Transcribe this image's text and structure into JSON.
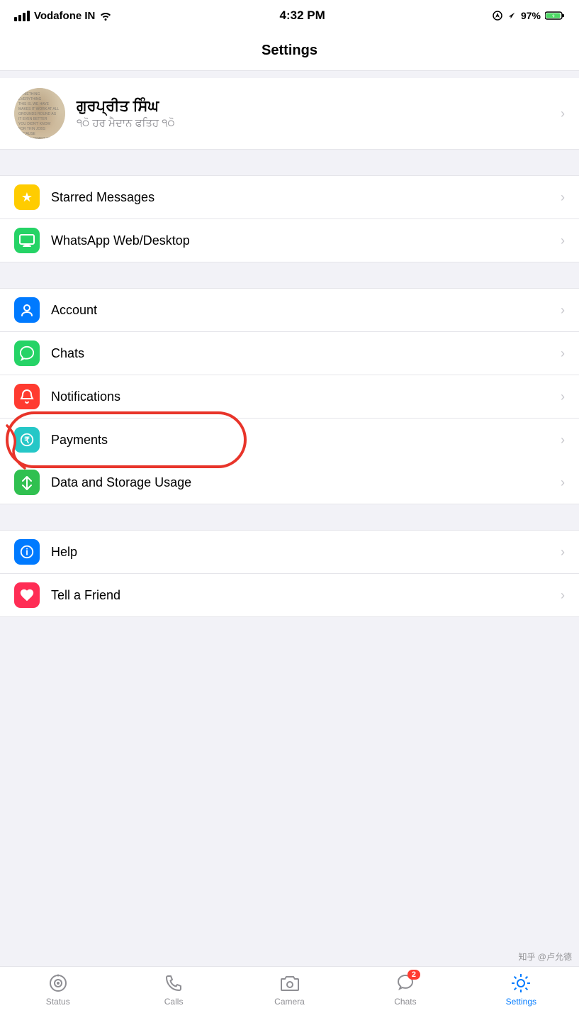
{
  "statusBar": {
    "carrier": "Vodafone IN",
    "time": "4:32 PM",
    "battery": "97%",
    "wifi": true
  },
  "navBar": {
    "title": "Settings"
  },
  "profile": {
    "name": "ਗੁਰਪ੍ਰੀਤ ਸਿੰਘ",
    "status": "੧੦ੋ ਹਰ ਮੈਦਾਨ ਫਤਿਹ ੧੦ੋ",
    "chevron": "›"
  },
  "groups": {
    "group1": [
      {
        "id": "starred-messages",
        "label": "Starred Messages",
        "iconClass": "icon-yellow",
        "iconSymbol": "★"
      },
      {
        "id": "whatsapp-web",
        "label": "WhatsApp Web/Desktop",
        "iconClass": "icon-teal",
        "iconSymbol": "💻"
      }
    ],
    "group2": [
      {
        "id": "account",
        "label": "Account",
        "iconClass": "icon-blue",
        "iconSymbol": "🔑"
      },
      {
        "id": "chats",
        "label": "Chats",
        "iconClass": "icon-teal",
        "iconSymbol": "💬"
      },
      {
        "id": "notifications",
        "label": "Notifications",
        "iconClass": "icon-red",
        "iconSymbol": "🔔"
      },
      {
        "id": "payments",
        "label": "Payments",
        "iconClass": "icon-teal2",
        "iconSymbol": "₹",
        "annotated": true
      },
      {
        "id": "data-storage",
        "label": "Data and Storage Usage",
        "iconClass": "icon-green2",
        "iconSymbol": "↕"
      }
    ],
    "group3": [
      {
        "id": "help",
        "label": "Help",
        "iconClass": "icon-blue2",
        "iconSymbol": "ℹ"
      },
      {
        "id": "tell-friend",
        "label": "Tell a Friend",
        "iconClass": "icon-pink",
        "iconSymbol": "♥"
      }
    ]
  },
  "tabBar": {
    "items": [
      {
        "id": "status",
        "label": "Status",
        "active": false
      },
      {
        "id": "calls",
        "label": "Calls",
        "active": false
      },
      {
        "id": "camera",
        "label": "Camera",
        "active": false
      },
      {
        "id": "chats",
        "label": "Chats",
        "active": false,
        "badge": "2"
      },
      {
        "id": "settings",
        "label": "Settings",
        "active": true
      }
    ]
  },
  "watermark": "知乎 @卢允德"
}
